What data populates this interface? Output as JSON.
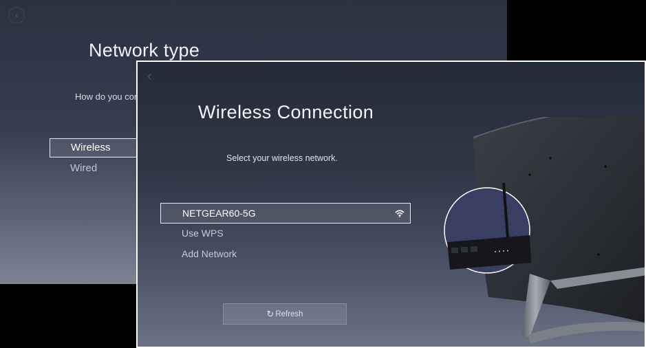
{
  "network_type_screen": {
    "title": "Network type",
    "prompt": "How do you con",
    "options": [
      "Wireless",
      "Wired"
    ],
    "selected_option": "Wireless"
  },
  "wireless_screen": {
    "title": "Wireless Connection",
    "prompt": "Select your wireless network.",
    "networks": [
      {
        "label": "NETGEAR60-5G",
        "selected": true,
        "icon": "wifi-signal-icon"
      },
      {
        "label": "Use WPS",
        "selected": false
      },
      {
        "label": "Add Network",
        "selected": false
      }
    ],
    "refresh_label": "Refresh",
    "refresh_icon": "refresh-icon"
  },
  "colors": {
    "selection_border": "#e8eaf0",
    "screen_frame": "#ffffff",
    "background_top": "#252a37"
  }
}
